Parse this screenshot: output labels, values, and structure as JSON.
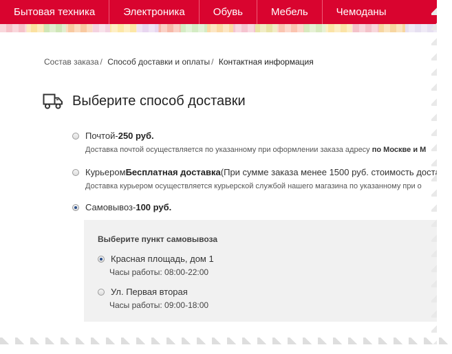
{
  "nav": {
    "items": [
      "Бытовая техника",
      "Электроника",
      "Обувь",
      "Мебель",
      "Чемоданы"
    ]
  },
  "breadcrumb": {
    "items": [
      "Состав заказа",
      "Способ доставки и оплаты",
      "Контактная информация"
    ],
    "separator": "/"
  },
  "page": {
    "title": "Выберите способ доставки",
    "icon": "truck-icon"
  },
  "options": [
    {
      "name": "Почтой",
      "dash": " - ",
      "price": "250 руб.",
      "selected": false,
      "desc_text": "Доставка почтой осуществляется по указанному при оформлении заказа адресу ",
      "desc_bold": "по Москве и М"
    },
    {
      "name": "Курьером ",
      "price": "Бесплатная доставка",
      "note": " (При сумме заказа менее 1500 руб. стоимость достав",
      "selected": false,
      "desc_text": "Доставка курьером осуществляется курьерской службой нашего магазина по указанному при о"
    },
    {
      "name": "Самовывоз",
      "dash": " - ",
      "price": "100 руб.",
      "selected": true
    }
  ],
  "pickup": {
    "title": "Выберите пункт самовывоза",
    "points": [
      {
        "address": "Красная площадь, дом 1",
        "hours": "Часы работы: 08:00-22:00",
        "selected": true
      },
      {
        "address": "Ул. Первая вторая",
        "hours": "Часы работы: 09:00-18:00",
        "selected": false
      }
    ]
  },
  "colors": {
    "nav_bg": "#d9042f",
    "panel_bg": "#f1f1f1"
  }
}
